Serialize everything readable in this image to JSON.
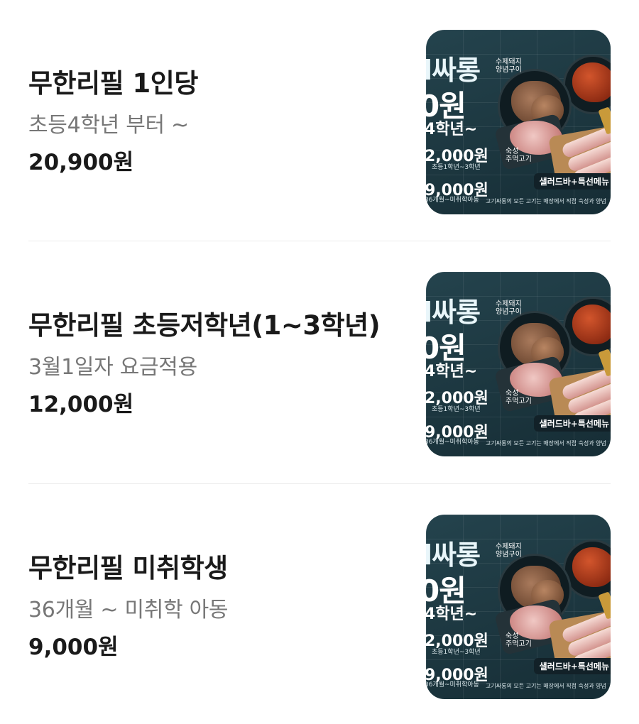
{
  "menu": [
    {
      "name": "무한리필 1인당",
      "description": "초등4학년 부터 ~",
      "price": "20,900원",
      "image": {
        "text_top": "l싸롱",
        "text_price_main": "0원",
        "text_grade": "4학년~",
        "text_price_2": "2,000원",
        "text_price_2_sub": "초등1학년~3학년",
        "text_price_3": "9,000원",
        "text_price_3_sub": "36개월~미취학아동",
        "text_handwritten_1": "수제돼지\n양념구이",
        "text_handwritten_2": "숙성\n주먹고기",
        "banner": "샐러드바+특선메뉴",
        "footer": "고기싸롱의 모든 고기는 매장에서 직접 숙성과 양념"
      }
    },
    {
      "name": "무한리필 초등저학년(1~3학년)",
      "description": "3월1일자 요금적용",
      "price": "12,000원",
      "image": {
        "text_top": "l싸롱",
        "text_price_main": "0원",
        "text_grade": "4학년~",
        "text_price_2": "2,000원",
        "text_price_2_sub": "초등1학년~3학년",
        "text_price_3": "9,000원",
        "text_price_3_sub": "36개월~미취학아동",
        "text_handwritten_1": "수제돼지\n양념구이",
        "text_handwritten_2": "숙성\n주먹고기",
        "banner": "샐러드바+특선메뉴",
        "footer": "고기싸롱의 모든 고기는 매장에서 직접 숙성과 양념"
      }
    },
    {
      "name": "무한리필 미취학생",
      "description": "36개월 ~ 미취학 아동",
      "price": "9,000원",
      "image": {
        "text_top": "l싸롱",
        "text_price_main": "0원",
        "text_grade": "4학년~",
        "text_price_2": "2,000원",
        "text_price_2_sub": "초등1학년~3학년",
        "text_price_3": "9,000원",
        "text_price_3_sub": "36개월~미취학아동",
        "text_handwritten_1": "수제돼지\n양념구이",
        "text_handwritten_2": "숙성\n주먹고기",
        "banner": "샐러드바+특선메뉴",
        "footer": "고기싸롱의 모든 고기는 매장에서 직접 숙성과 양념"
      }
    }
  ],
  "colors": {
    "title": "#1a1a1a",
    "description": "#777777",
    "divider": "#ececec",
    "thumb_bg": "#1b3640",
    "highlight": "#f2c94c"
  }
}
